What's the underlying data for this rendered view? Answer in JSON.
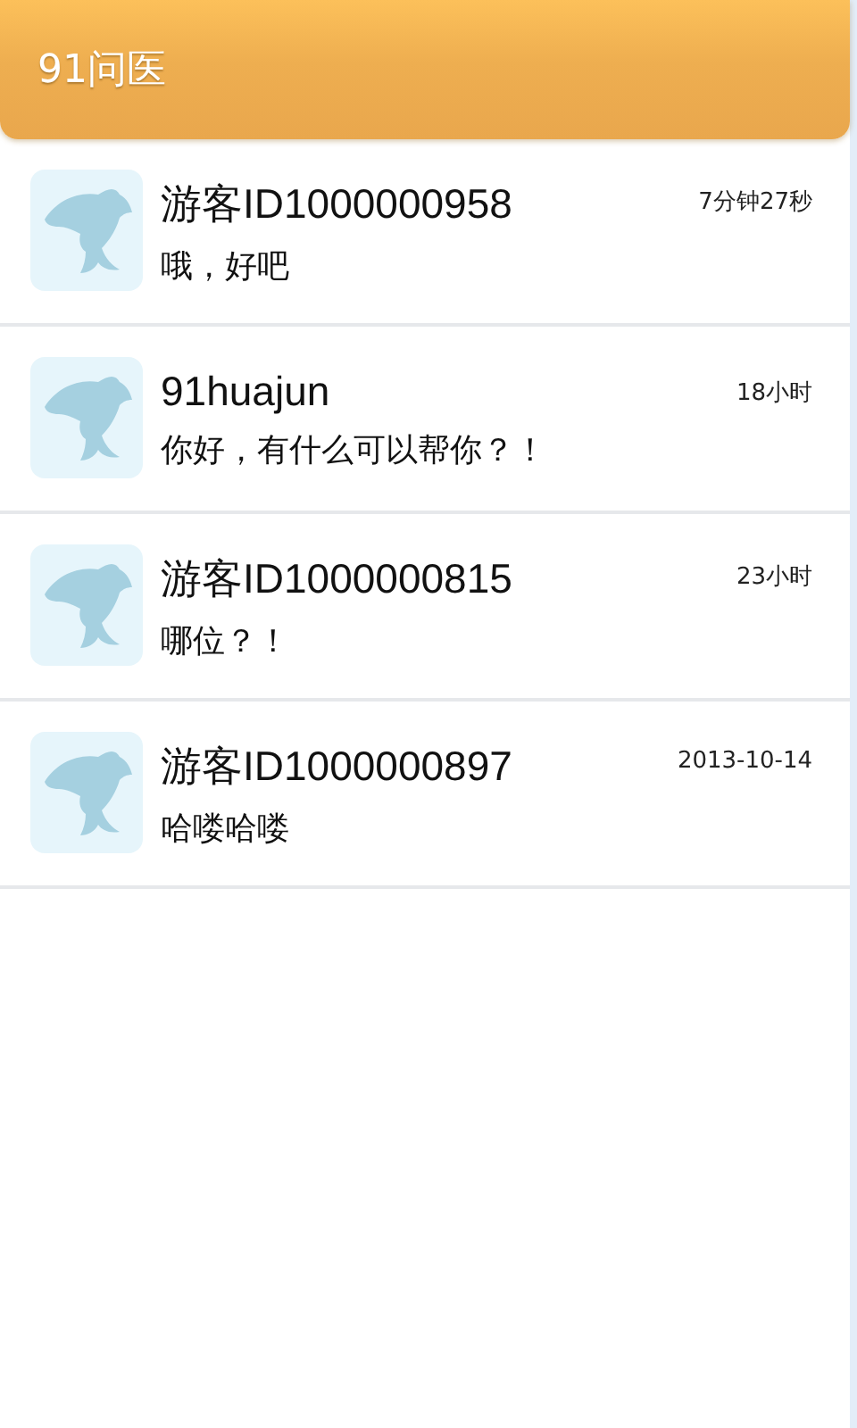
{
  "header": {
    "title": "91问医"
  },
  "conversations": [
    {
      "name": "游客ID1000000958",
      "time": "7分钟27秒",
      "message": "哦，好吧"
    },
    {
      "name": "91huajun",
      "time": "18小时",
      "message": "你好，有什么可以帮你？！"
    },
    {
      "name": "游客ID1000000815",
      "time": "23小时",
      "message": "哪位？！"
    },
    {
      "name": "游客ID1000000897",
      "time": "2013-10-14",
      "message": "哈喽哈喽"
    }
  ]
}
